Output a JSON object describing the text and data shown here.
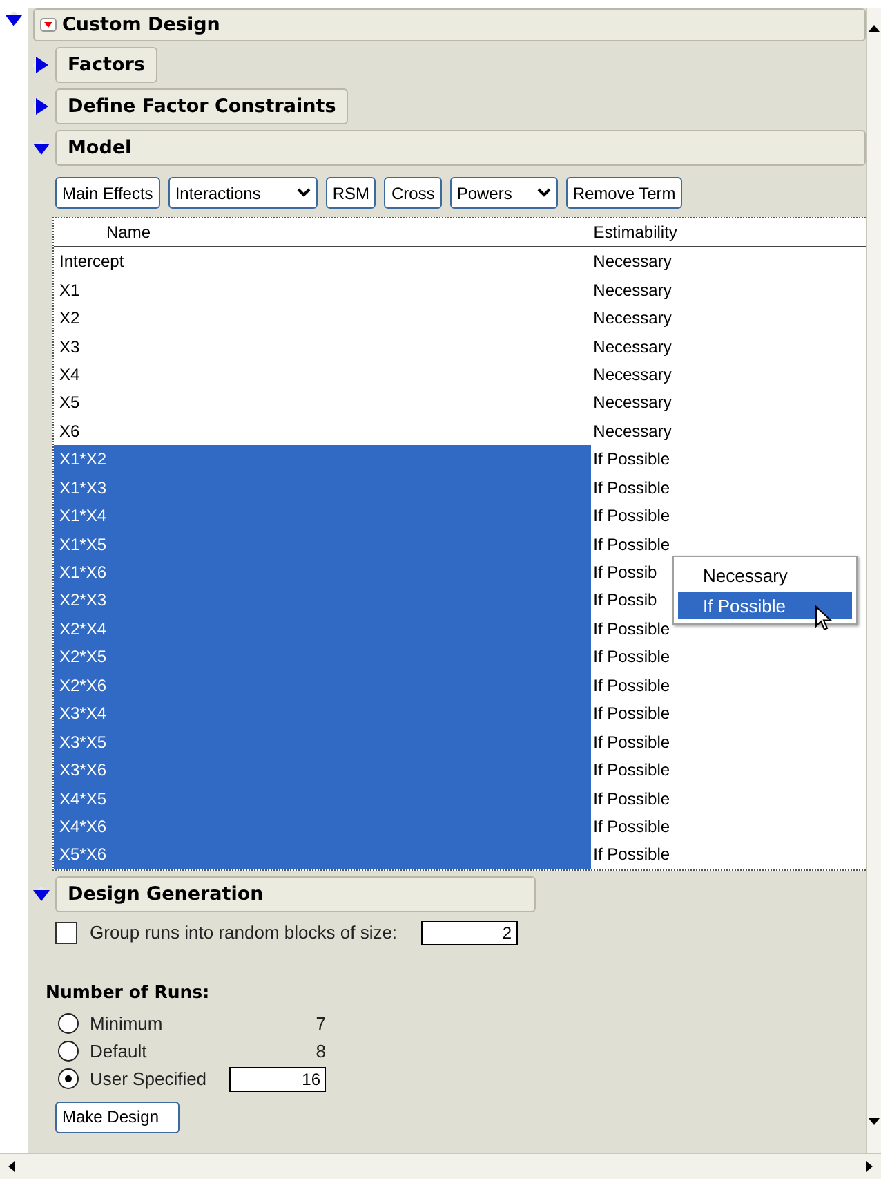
{
  "title": {
    "label": "Custom Design",
    "expanded": true
  },
  "sections": [
    {
      "label": "Factors",
      "expanded": false
    },
    {
      "label": "Define Factor Constraints",
      "expanded": false
    },
    {
      "label": "Model",
      "expanded": true
    }
  ],
  "toolbar": [
    {
      "label": "Main Effects",
      "kind": "button"
    },
    {
      "label": "Interactions",
      "kind": "dropdown"
    },
    {
      "label": "RSM",
      "kind": "button"
    },
    {
      "label": "Cross",
      "kind": "button"
    },
    {
      "label": "Powers",
      "kind": "dropdown"
    },
    {
      "label": "Remove Term",
      "kind": "button"
    }
  ],
  "table": {
    "columns": [
      "Name",
      "Estimability"
    ],
    "rows": [
      {
        "name": "Intercept",
        "estimability": "Necessary",
        "selected": false
      },
      {
        "name": "X1",
        "estimability": "Necessary",
        "selected": false
      },
      {
        "name": "X2",
        "estimability": "Necessary",
        "selected": false
      },
      {
        "name": "X3",
        "estimability": "Necessary",
        "selected": false
      },
      {
        "name": "X4",
        "estimability": "Necessary",
        "selected": false
      },
      {
        "name": "X5",
        "estimability": "Necessary",
        "selected": false
      },
      {
        "name": "X6",
        "estimability": "Necessary",
        "selected": false
      },
      {
        "name": "X1*X2",
        "estimability": "If Possible",
        "selected": true
      },
      {
        "name": "X1*X3",
        "estimability": "If Possible",
        "selected": true
      },
      {
        "name": "X1*X4",
        "estimability": "If Possible",
        "selected": true
      },
      {
        "name": "X1*X5",
        "estimability": "If Possible",
        "selected": true
      },
      {
        "name": "X1*X6",
        "estimability": "If Possib",
        "selected": true
      },
      {
        "name": "X2*X3",
        "estimability": "If Possib",
        "selected": true
      },
      {
        "name": "X2*X4",
        "estimability": "If Possible",
        "selected": true
      },
      {
        "name": "X2*X5",
        "estimability": "If Possible",
        "selected": true
      },
      {
        "name": "X2*X6",
        "estimability": "If Possible",
        "selected": true
      },
      {
        "name": "X3*X4",
        "estimability": "If Possible",
        "selected": true
      },
      {
        "name": "X3*X5",
        "estimability": "If Possible",
        "selected": true
      },
      {
        "name": "X3*X6",
        "estimability": "If Possible",
        "selected": true
      },
      {
        "name": "X4*X5",
        "estimability": "If Possible",
        "selected": true
      },
      {
        "name": "X4*X6",
        "estimability": "If Possible",
        "selected": true
      },
      {
        "name": "X5*X6",
        "estimability": "If Possible",
        "selected": true
      }
    ]
  },
  "popup": {
    "items": [
      {
        "label": "Necessary",
        "selected": false
      },
      {
        "label": "If Possible",
        "selected": true
      }
    ]
  },
  "design_generation": {
    "label": "Design Generation",
    "expanded": true,
    "blocks": {
      "label": "Group runs into random blocks of size:",
      "checked": false,
      "value": "2"
    }
  },
  "runs": {
    "title": "Number of Runs:",
    "options": [
      {
        "label": "Minimum",
        "selected": false,
        "kind": "value",
        "value": "7"
      },
      {
        "label": "Default",
        "selected": false,
        "kind": "value",
        "value": "8"
      },
      {
        "label": "User Specified",
        "selected": true,
        "kind": "field",
        "value": "16"
      }
    ]
  },
  "make_design": "Make Design"
}
